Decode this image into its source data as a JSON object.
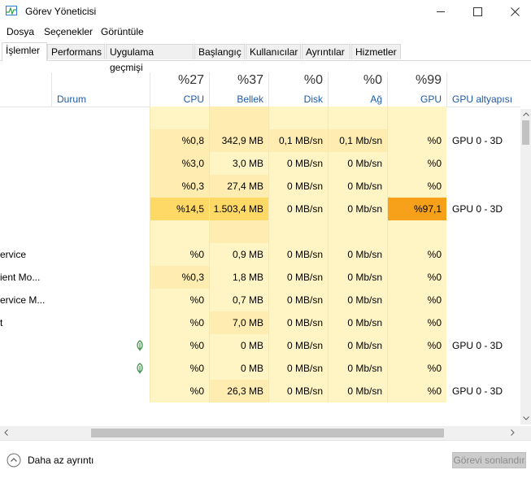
{
  "window": {
    "title": "Görev Yöneticisi"
  },
  "menu": [
    "Dosya",
    "Seçenekler",
    "Görüntüle"
  ],
  "tabs": [
    "İşlemler",
    "Performans",
    "Uygulama geçmişi",
    "Başlangıç",
    "Kullanıcılar",
    "Ayrıntılar",
    "Hizmetler"
  ],
  "columns": {
    "status": "Durum",
    "cpu": {
      "pct": "%27",
      "label": "CPU"
    },
    "mem": {
      "pct": "%37",
      "label": "Bellek"
    },
    "disk": {
      "pct": "%0",
      "label": "Disk"
    },
    "net": {
      "pct": "%0",
      "label": "Ağ"
    },
    "gpu": {
      "pct": "%99",
      "label": "GPU"
    },
    "gpu_engine": "GPU altyapısı"
  },
  "rows": [
    {
      "name": "",
      "status": "",
      "cpu": "",
      "mem": "",
      "disk": "",
      "net": "",
      "gpu": "",
      "engine": ""
    },
    {
      "name": "",
      "status": "",
      "cpu": "%0,8",
      "mem": "342,9 MB",
      "disk": "0,1 MB/sn",
      "net": "0,1 Mb/sn",
      "gpu": "%0",
      "engine": "GPU 0 - 3D"
    },
    {
      "name": "",
      "status": "",
      "cpu": "%3,0",
      "mem": "3,0 MB",
      "disk": "0 MB/sn",
      "net": "0 Mb/sn",
      "gpu": "%0",
      "engine": ""
    },
    {
      "name": "",
      "status": "",
      "cpu": "%0,3",
      "mem": "27,4 MB",
      "disk": "0 MB/sn",
      "net": "0 Mb/sn",
      "gpu": "%0",
      "engine": ""
    },
    {
      "name": "",
      "status": "",
      "cpu": "%14,5",
      "mem": "1.503,4 MB",
      "disk": "0 MB/sn",
      "net": "0 Mb/sn",
      "gpu": "%97,1",
      "engine": "GPU 0 - 3D"
    },
    {
      "name": "",
      "status": "",
      "cpu": "",
      "mem": "",
      "disk": "",
      "net": "",
      "gpu": "",
      "engine": ""
    },
    {
      "name": "ervice",
      "status": "",
      "cpu": "%0",
      "mem": "0,9 MB",
      "disk": "0 MB/sn",
      "net": "0 Mb/sn",
      "gpu": "%0",
      "engine": ""
    },
    {
      "name": "ient Mo...",
      "status": "",
      "cpu": "%0,3",
      "mem": "1,8 MB",
      "disk": "0 MB/sn",
      "net": "0 Mb/sn",
      "gpu": "%0",
      "engine": ""
    },
    {
      "name": "ervice M...",
      "status": "",
      "cpu": "%0",
      "mem": "0,7 MB",
      "disk": "0 MB/sn",
      "net": "0 Mb/sn",
      "gpu": "%0",
      "engine": ""
    },
    {
      "name": "t",
      "status": "",
      "cpu": "%0",
      "mem": "7,0 MB",
      "disk": "0 MB/sn",
      "net": "0 Mb/sn",
      "gpu": "%0",
      "engine": ""
    },
    {
      "name": "",
      "status": "leaf",
      "cpu": "%0",
      "mem": "0 MB",
      "disk": "0 MB/sn",
      "net": "0 Mb/sn",
      "gpu": "%0",
      "engine": "GPU 0 - 3D"
    },
    {
      "name": "",
      "status": "leaf",
      "cpu": "%0",
      "mem": "0 MB",
      "disk": "0 MB/sn",
      "net": "0 Mb/sn",
      "gpu": "%0",
      "engine": ""
    },
    {
      "name": "",
      "status": "",
      "cpu": "%0",
      "mem": "26,3 MB",
      "disk": "0 MB/sn",
      "net": "0 Mb/sn",
      "gpu": "%0",
      "engine": "GPU 0 - 3D"
    }
  ],
  "footer": {
    "fewer_details": "Daha az ayrıntı",
    "end_task": "Görevi sonlandır"
  },
  "colors": {
    "cell_light": "#fff4c4",
    "cell_mid": "#ffecb0",
    "cell_strong": "#ffd966",
    "gpu_hot": "#f7a11a",
    "header_blue": "#1e5aa8"
  }
}
